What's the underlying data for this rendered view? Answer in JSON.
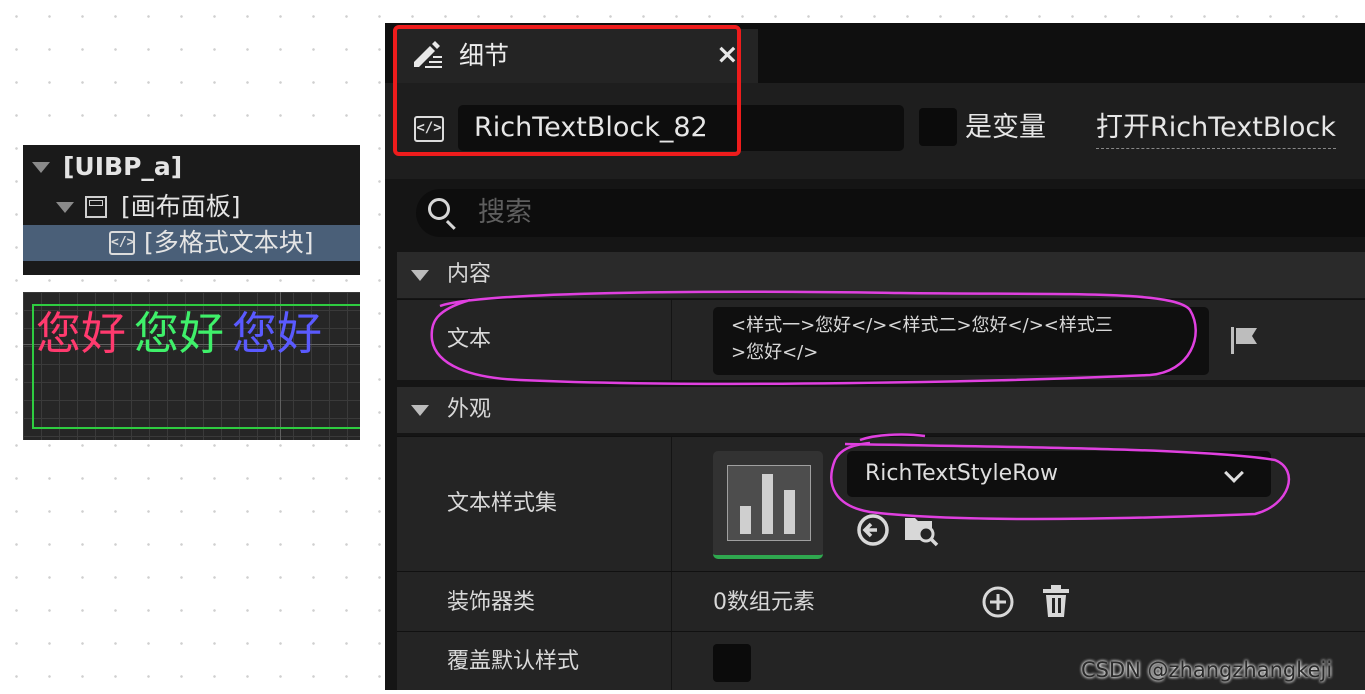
{
  "hierarchy": {
    "root_label": "[UIBP_a]",
    "canvas_label": "[画布面板]",
    "richtext_label": "[多格式文本块]"
  },
  "preview": {
    "segments": [
      {
        "text": "您好",
        "color": "#ff3a6e"
      },
      {
        "text": "您好",
        "color": "#3ff06a"
      },
      {
        "text": "您好",
        "color": "#5a5aff"
      }
    ]
  },
  "details": {
    "tab_title": "细节",
    "tab_close": "×",
    "widget_name": "RichTextBlock_82",
    "is_variable_label": "是变量",
    "open_link": "打开RichTextBlock",
    "search_placeholder": "搜索",
    "sections": {
      "content": "内容",
      "appearance": "外观"
    },
    "text_property": {
      "label": "文本",
      "value_line1": "<样式一>您好</><样式二>您好</><样式三",
      "value_line2": ">您好</>"
    },
    "style_set": {
      "label": "文本样式集",
      "selected": "RichTextStyleRow"
    },
    "decorator": {
      "label": "装饰器类",
      "count": "0数组元素"
    },
    "override_default": {
      "label": "覆盖默认样式"
    }
  },
  "watermark": "CSDN @zhangzhangkeji",
  "colors": {
    "highlight_red": "#ee1c1c",
    "annotation_pink": "#e040e0",
    "active_green": "#2fa84f"
  }
}
